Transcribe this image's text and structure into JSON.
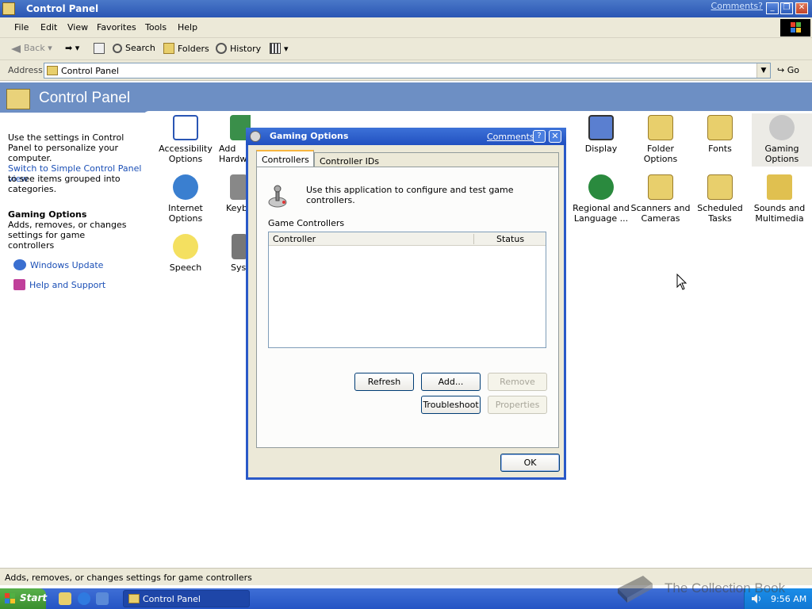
{
  "window": {
    "title": "Control Panel",
    "comments_link": "Comments?",
    "buttons": {
      "minimize": "_",
      "restore": "❐",
      "close": "✕"
    }
  },
  "menu": [
    "File",
    "Edit",
    "View",
    "Favorites",
    "Tools",
    "Help"
  ],
  "toolbar": {
    "back": "Back",
    "search": "Search",
    "folders": "Folders",
    "history": "History"
  },
  "address": {
    "label": "Address",
    "value": "Control Panel",
    "go": "Go"
  },
  "header": {
    "title": "Control Panel"
  },
  "leftpane": {
    "intro": "Use the settings in Control Panel to personalize your computer.",
    "switch_link": "Switch to Simple Control Panel view",
    "switch_rest": "to see items grouped into categories.",
    "selected_title": "Gaming Options",
    "selected_desc": "Adds, removes, or changes settings for game controllers",
    "links": [
      "Windows Update",
      "Help and Support"
    ]
  },
  "items": [
    {
      "label": "Accessibility Options"
    },
    {
      "label": "Add Hardware"
    },
    {
      "label": "Display"
    },
    {
      "label": "Folder Options"
    },
    {
      "label": "Fonts"
    },
    {
      "label": "Gaming Options"
    },
    {
      "label": "Internet Options"
    },
    {
      "label": "Keyboard"
    },
    {
      "label": "Regional and Language ..."
    },
    {
      "label": "Scanners and Cameras"
    },
    {
      "label": "Scheduled Tasks"
    },
    {
      "label": "Sounds and Multimedia"
    },
    {
      "label": "Speech"
    },
    {
      "label": "System"
    }
  ],
  "dialog": {
    "title": "Gaming Options",
    "comments_link": "Comments?",
    "help": "?",
    "close": "✕",
    "tabs": [
      "Controllers",
      "Controller IDs"
    ],
    "description": "Use this application to configure and test game controllers.",
    "group_label": "Game Controllers",
    "columns": [
      "Controller",
      "Status"
    ],
    "buttons": {
      "refresh": "Refresh",
      "add": "Add...",
      "remove": "Remove",
      "troubleshoot": "Troubleshoot",
      "properties": "Properties",
      "ok": "OK"
    }
  },
  "statusbar": {
    "text": "Adds, removes, or changes settings for game controllers"
  },
  "taskbar": {
    "start": "Start",
    "task": "Control Panel",
    "clock": "9:56 AM"
  },
  "watermark": "The Collection Book",
  "colors": {
    "title_blue": "#2a56b4",
    "link_blue": "#1b4fb6",
    "start_green": "#3a8f2e",
    "panel_bg": "#ece9d8"
  }
}
